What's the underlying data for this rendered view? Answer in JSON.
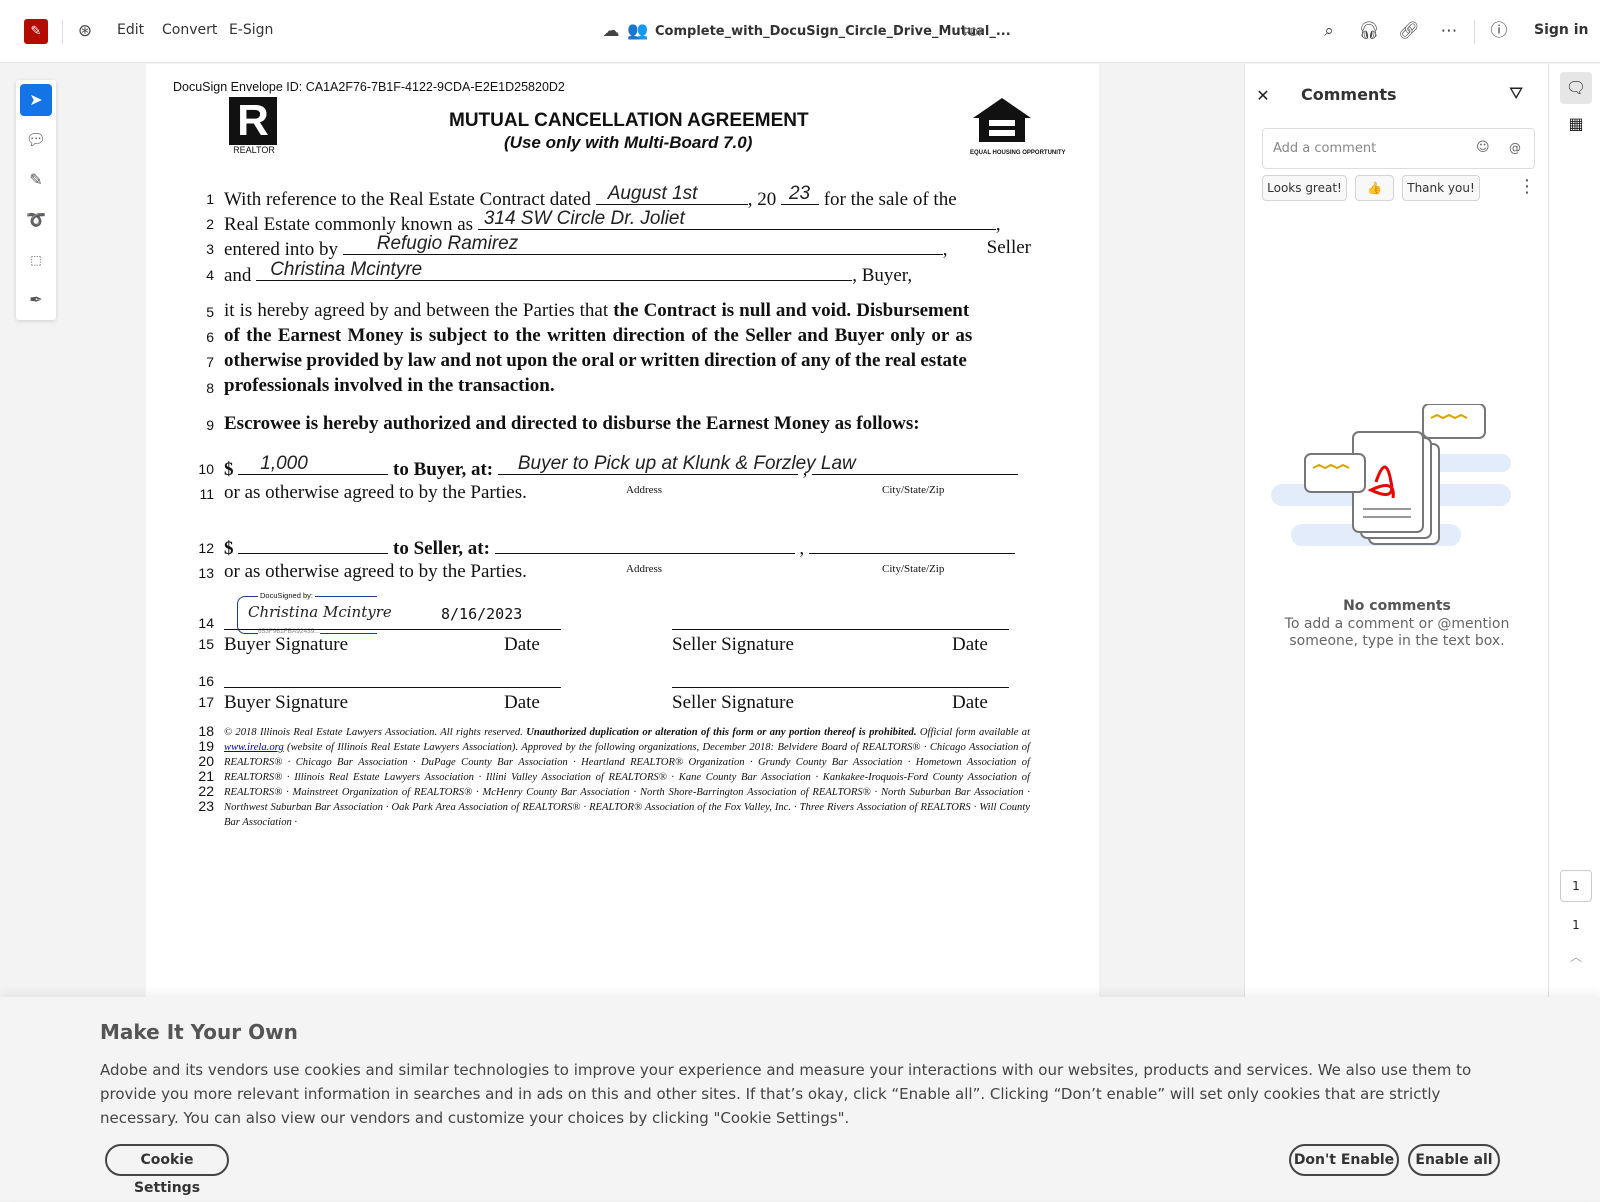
{
  "topbar": {
    "menu": [
      "Edit",
      "Convert",
      "E-Sign"
    ],
    "filename": "Complete_with_DocuSign_Circle_Drive_Mutual_...",
    "filetype": "PDF",
    "sign_in": "Sign in",
    "brand_color": "#b30b00"
  },
  "document": {
    "envelope_id": "DocuSign Envelope ID: CA1A2F76-7B1F-4122-9CDA-E2E1D25820D2",
    "realtor_logo": "REALTOR",
    "eho_logo": "EQUAL HOUSING OPPORTUNITY",
    "title": "MUTUAL CANCELLATION AGREEMENT",
    "subtitle": "(Use only with Multi-Board 7.0)",
    "line_numbers": [
      "1",
      "2",
      "3",
      "4",
      "5",
      "6",
      "7",
      "8",
      "9",
      "10",
      "11",
      "12",
      "13",
      "14",
      "15",
      "16",
      "17",
      "18",
      "19",
      "20",
      "21",
      "22",
      "23"
    ],
    "l1a": "With reference to the Real Estate Contract dated",
    "date_value": "August 1st",
    "l1b": ", 20",
    "year_value": "23",
    "l1c": "for the sale of the",
    "l2": "Real Estate commonly known as",
    "address_value": "314 SW Circle Dr. Joliet",
    "l2end": ",",
    "l3": "entered into by",
    "seller_value": "Refugio Ramirez",
    "l3end": ",",
    "l3seller": "Seller",
    "l4": "and",
    "buyer_value": "Christina Mcintyre",
    "l4end": ", Buyer,",
    "l5a": "it is hereby agreed by and between the Parties that ",
    "l5b": "the Contract is null and void. Disbursement",
    "l6": "of the Earnest Money is subject to the written direction of the Seller and Buyer only or as",
    "l7": "otherwise provided by law and not upon the oral or written direction of any of the real estate",
    "l8": "professionals involved in the transaction.",
    "l9": "Escrowee is hereby authorized and directed to disburse the Earnest Money as follows:",
    "dollar": "$",
    "buyer_amount": "1,000",
    "to_buyer": "to Buyer, at:",
    "buyer_address": "Buyer to Pick up at Klunk & Forzley Law",
    "l11": "or as otherwise agreed to by the Parties.",
    "address_label": "Address",
    "csz_label": "City/State/Zip",
    "to_seller": "to Seller, at:",
    "comma": ",",
    "l13": "or as otherwise agreed to by the Parties.",
    "docusigned_by": "DocuSigned by:",
    "signature": "Christina Mcintyre",
    "signature_id": "653F961FBA92439...",
    "sign_date": "8/16/2023",
    "buyer_signature": "Buyer Signature",
    "seller_signature": "Seller Signature",
    "date_label": "Date",
    "footer_a": "© 2018 Illinois Real Estate Lawyers Association. All rights reserved. ",
    "footer_b": "Unauthorized duplication or alteration of this form or any portion thereof is prohibited.",
    "footer_c": " Official form available at ",
    "footer_link": "www.irela.org",
    "footer_d": " (website of Illinois Real Estate Lawyers Association). Approved by the following organizations, December 2018: Belvidere Board of REALTORS® · Chicago Association of REALTORS® · Chicago Bar Association · DuPage County Bar Association · Heartland REALTOR® Organization · Grundy County Bar Association · Hometown Association of REALTORS® · Illinois Real Estate Lawyers Association · Illini Valley Association of REALTORS® · Kane County Bar Association · Kankakee-Iroquois-Ford County Association of REALTORS® · Mainstreet Organization of REALTORS® · McHenry County Bar Association · North Shore-Barrington Association of REALTORS® · North Suburban Bar Association · Northwest Suburban Bar Association · Oak Park Area Association of REALTORS® · REALTOR® Association of the Fox Valley, Inc. · Three Rivers Association of REALTORS · Will County Bar Association ·"
  },
  "comments": {
    "title": "Comments",
    "placeholder": "Add a comment",
    "quick": [
      "Looks great!",
      "👍",
      "Thank you!"
    ],
    "empty_title": "No comments",
    "empty_text": "To add a comment or @mention someone, type in the text box."
  },
  "page_nav": {
    "current": "1",
    "total": "1"
  },
  "cookie": {
    "title": "Make It Your Own",
    "text": "Adobe and its vendors use cookies and similar technologies to improve your experience and measure your interactions with our websites, products and services. We also use them to provide you more relevant information in searches and in ads on this and other sites. If that’s okay, click “Enable all”. Clicking “Don’t enable” will set only cookies that are strictly necessary. You can also view our vendors and customize your choices by clicking \"Cookie Settings\".",
    "settings": "Cookie Settings",
    "dont_enable": "Don't Enable",
    "enable_all": "Enable all"
  }
}
